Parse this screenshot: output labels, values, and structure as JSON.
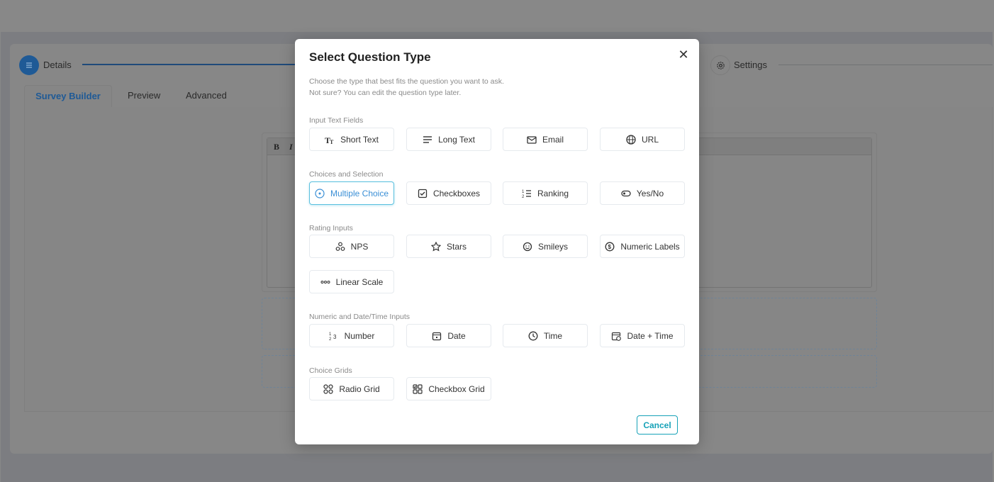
{
  "background": {
    "steps": [
      {
        "label": "Details",
        "icon": "list-icon"
      },
      {
        "label": "Settings",
        "icon": "gear-icon"
      }
    ],
    "tabs": [
      "Survey Builder",
      "Preview",
      "Advanced"
    ],
    "editor_toolbar": {
      "bold": "B",
      "italic": "I"
    }
  },
  "modal": {
    "title": "Select Question Type",
    "description_line1": "Choose the type that best fits the question you want to ask.",
    "description_line2": "Not sure? You can edit the question type later.",
    "sections": [
      {
        "title": "Input Text Fields",
        "items": [
          {
            "label": "Short Text",
            "icon": "text-size-icon"
          },
          {
            "label": "Long Text",
            "icon": "paragraph-lines-icon"
          },
          {
            "label": "Email",
            "icon": "envelope-icon"
          },
          {
            "label": "URL",
            "icon": "globe-icon"
          }
        ]
      },
      {
        "title": "Choices and Selection",
        "items": [
          {
            "label": "Multiple Choice",
            "icon": "radio-icon",
            "selected": true
          },
          {
            "label": "Checkboxes",
            "icon": "checkbox-icon"
          },
          {
            "label": "Ranking",
            "icon": "ordered-list-icon"
          },
          {
            "label": "Yes/No",
            "icon": "toggle-icon"
          }
        ]
      },
      {
        "title": "Rating Inputs",
        "items": [
          {
            "label": "NPS",
            "icon": "nps-icon"
          },
          {
            "label": "Stars",
            "icon": "star-icon"
          },
          {
            "label": "Smileys",
            "icon": "smiley-icon"
          },
          {
            "label": "Numeric Labels",
            "icon": "dollar-circle-icon"
          },
          {
            "label": "Linear Scale",
            "icon": "dots-icon"
          }
        ]
      },
      {
        "title": "Numeric and Date/Time Inputs",
        "items": [
          {
            "label": "Number",
            "icon": "number-icon"
          },
          {
            "label": "Date",
            "icon": "calendar-icon"
          },
          {
            "label": "Time",
            "icon": "clock-icon"
          },
          {
            "label": "Date + Time",
            "icon": "calendar-clock-icon"
          }
        ]
      },
      {
        "title": "Choice Grids",
        "items": [
          {
            "label": "Radio Grid",
            "icon": "radio-grid-icon"
          },
          {
            "label": "Checkbox Grid",
            "icon": "checkbox-grid-icon"
          }
        ]
      }
    ],
    "cancel_label": "Cancel",
    "colors": {
      "accent": "#17a2b8",
      "selected_border": "#5bc0de",
      "selected_text": "#3a8fd6",
      "primary": "#1f5a96"
    }
  }
}
